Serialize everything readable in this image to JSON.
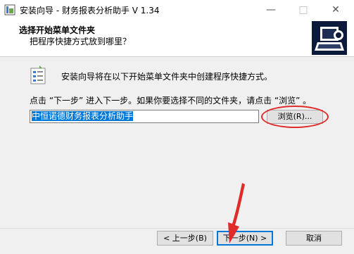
{
  "window": {
    "title": "安装向导 - 财务报表分析助手 V 1.34"
  },
  "header": {
    "title": "选择开始菜单文件夹",
    "subtitle": "把程序快捷方式放到哪里？"
  },
  "main": {
    "intro": "安装向导将在以下开始菜单文件夹中创建程序快捷方式。",
    "instruction": "点击 “下一步” 进入下一步。如果你要选择不同的文件夹，请点击 “浏览” 。",
    "folder_value": "中恒诺德财务报表分析助手",
    "browse_label": "浏览(R)..."
  },
  "footer": {
    "back_label": "< 上一步(B)",
    "next_label": "下一步(N) >",
    "cancel_label": "取消"
  },
  "annotation": {
    "color": "#e02b2b"
  }
}
